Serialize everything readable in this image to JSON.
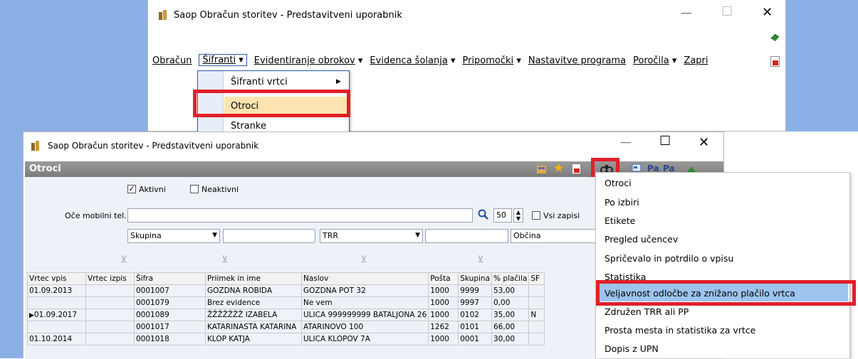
{
  "main_window": {
    "title": "Saop Obračun storitev - Predstavitveni uporabnik",
    "menu": [
      {
        "label": "Obračun",
        "arrow": ""
      },
      {
        "label": "Šifranti",
        "arrow": "▾"
      },
      {
        "label": "Evidentiranje obrokov",
        "arrow": "▾"
      },
      {
        "label": "Evidenca šolanja",
        "arrow": "▾"
      },
      {
        "label": "Pripomočki",
        "arrow": "▾"
      },
      {
        "label": "Nastavitve programa",
        "arrow": ""
      },
      {
        "label": "Poročila",
        "arrow": "▾"
      },
      {
        "label": "Zapri",
        "arrow": ""
      }
    ],
    "dropdown": {
      "items": [
        "Šifranti vrtci",
        "Otroci",
        "Stranke"
      ],
      "submenu_arrow": "▶"
    },
    "controls": {
      "minimize": "—",
      "maximize": "☐",
      "close": "✕"
    }
  },
  "child_window": {
    "title": "Saop Obračun storitev - Predstavitveni uporabnik",
    "panel_title": "Otroci",
    "filters": {
      "aktivni_label": "Aktivni",
      "neaktivni_label": "Neaktivni",
      "search_label": "Oče mobilni tel.",
      "count_value": "50",
      "vsi_zapisi_label": "Vsi zapisi",
      "combo1": "Skupina",
      "combo2": "TRR",
      "field3": "Občina"
    },
    "table": {
      "headers": [
        "Vrtec vpis",
        "Vrtec izpis",
        "Šifra",
        "Priimek in ime",
        "Naslov",
        "Pošta",
        "Skupina",
        "% plačila",
        "SF"
      ],
      "rows": [
        [
          "01.09.2013",
          "",
          "0001007",
          "GOZDNA ROBIDA",
          "GOZDNA POT 32",
          "1000",
          "9999",
          "53,00",
          ""
        ],
        [
          "",
          "",
          "0001079",
          "Brez evidence",
          "Ne vem",
          "1000",
          "9997",
          "0,00",
          ""
        ],
        [
          "01.09.2017",
          "",
          "0001089",
          "ŽŽŽŽŽŽŽ IZABELA",
          "ULICA 999999999 BATALJONA 26",
          "1000",
          "0102",
          "35,00",
          "N"
        ],
        [
          "",
          "",
          "0001017",
          "KATARINASTA KATARINA",
          "ATARINOVO 100",
          "1262",
          "0101",
          "66,00",
          ""
        ],
        [
          "01.10.2014",
          "",
          "0001018",
          "KLOP KATJA",
          "ULICA KLOPOV 7A",
          "1000",
          "0001",
          "30,00",
          ""
        ]
      ]
    }
  },
  "context_menu": {
    "items": [
      "Otroci",
      "Po izbiri",
      "Etikete",
      "Pregled učencev",
      "Spričevalo in potrdilo o vpisu",
      "Statistika",
      "Veljavnost odločbe za znižano plačilo vrtca",
      "Združen TRR ali PP",
      "Prosta mesta in statistika za vrtce",
      "Dopis z UPN"
    ]
  },
  "colors": {
    "highlight": "#e0202a",
    "selection": "#9dc3ef",
    "panel_header": "#8c8c8c",
    "background": "#8bb0e6"
  }
}
